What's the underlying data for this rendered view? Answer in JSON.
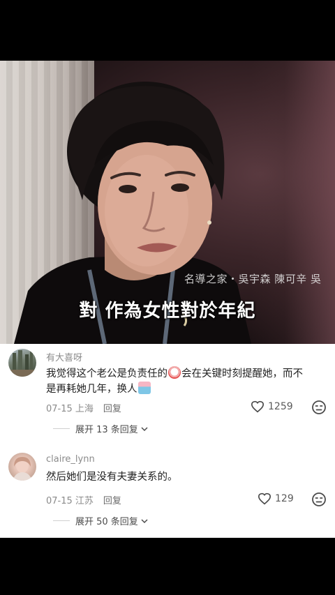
{
  "video": {
    "watermark": "名導之家・吳宇森 陳可辛 吳",
    "subtitle": "對 作為女性對於年紀"
  },
  "comments": [
    {
      "username": "有大喜呀",
      "text_part1": "我觉得这个老公是负责任的",
      "text_part2": "会在关键时刻提醒她，而不",
      "text_part3": "是再耗她几年，换人",
      "date_location": "07-15 上海",
      "reply_label": "回复",
      "likes": "1259",
      "expand_label": "展开 13 条回复"
    },
    {
      "username": "claire_lynn",
      "text": "然后她们是没有夫妻关系的。",
      "date_location": "07-15 江苏",
      "reply_label": "回复",
      "likes": "129",
      "expand_label": "展开 50 条回复"
    }
  ],
  "colors": {
    "background": "#000000",
    "panel": "#ffffff",
    "meta_text": "#8a8a8a"
  }
}
